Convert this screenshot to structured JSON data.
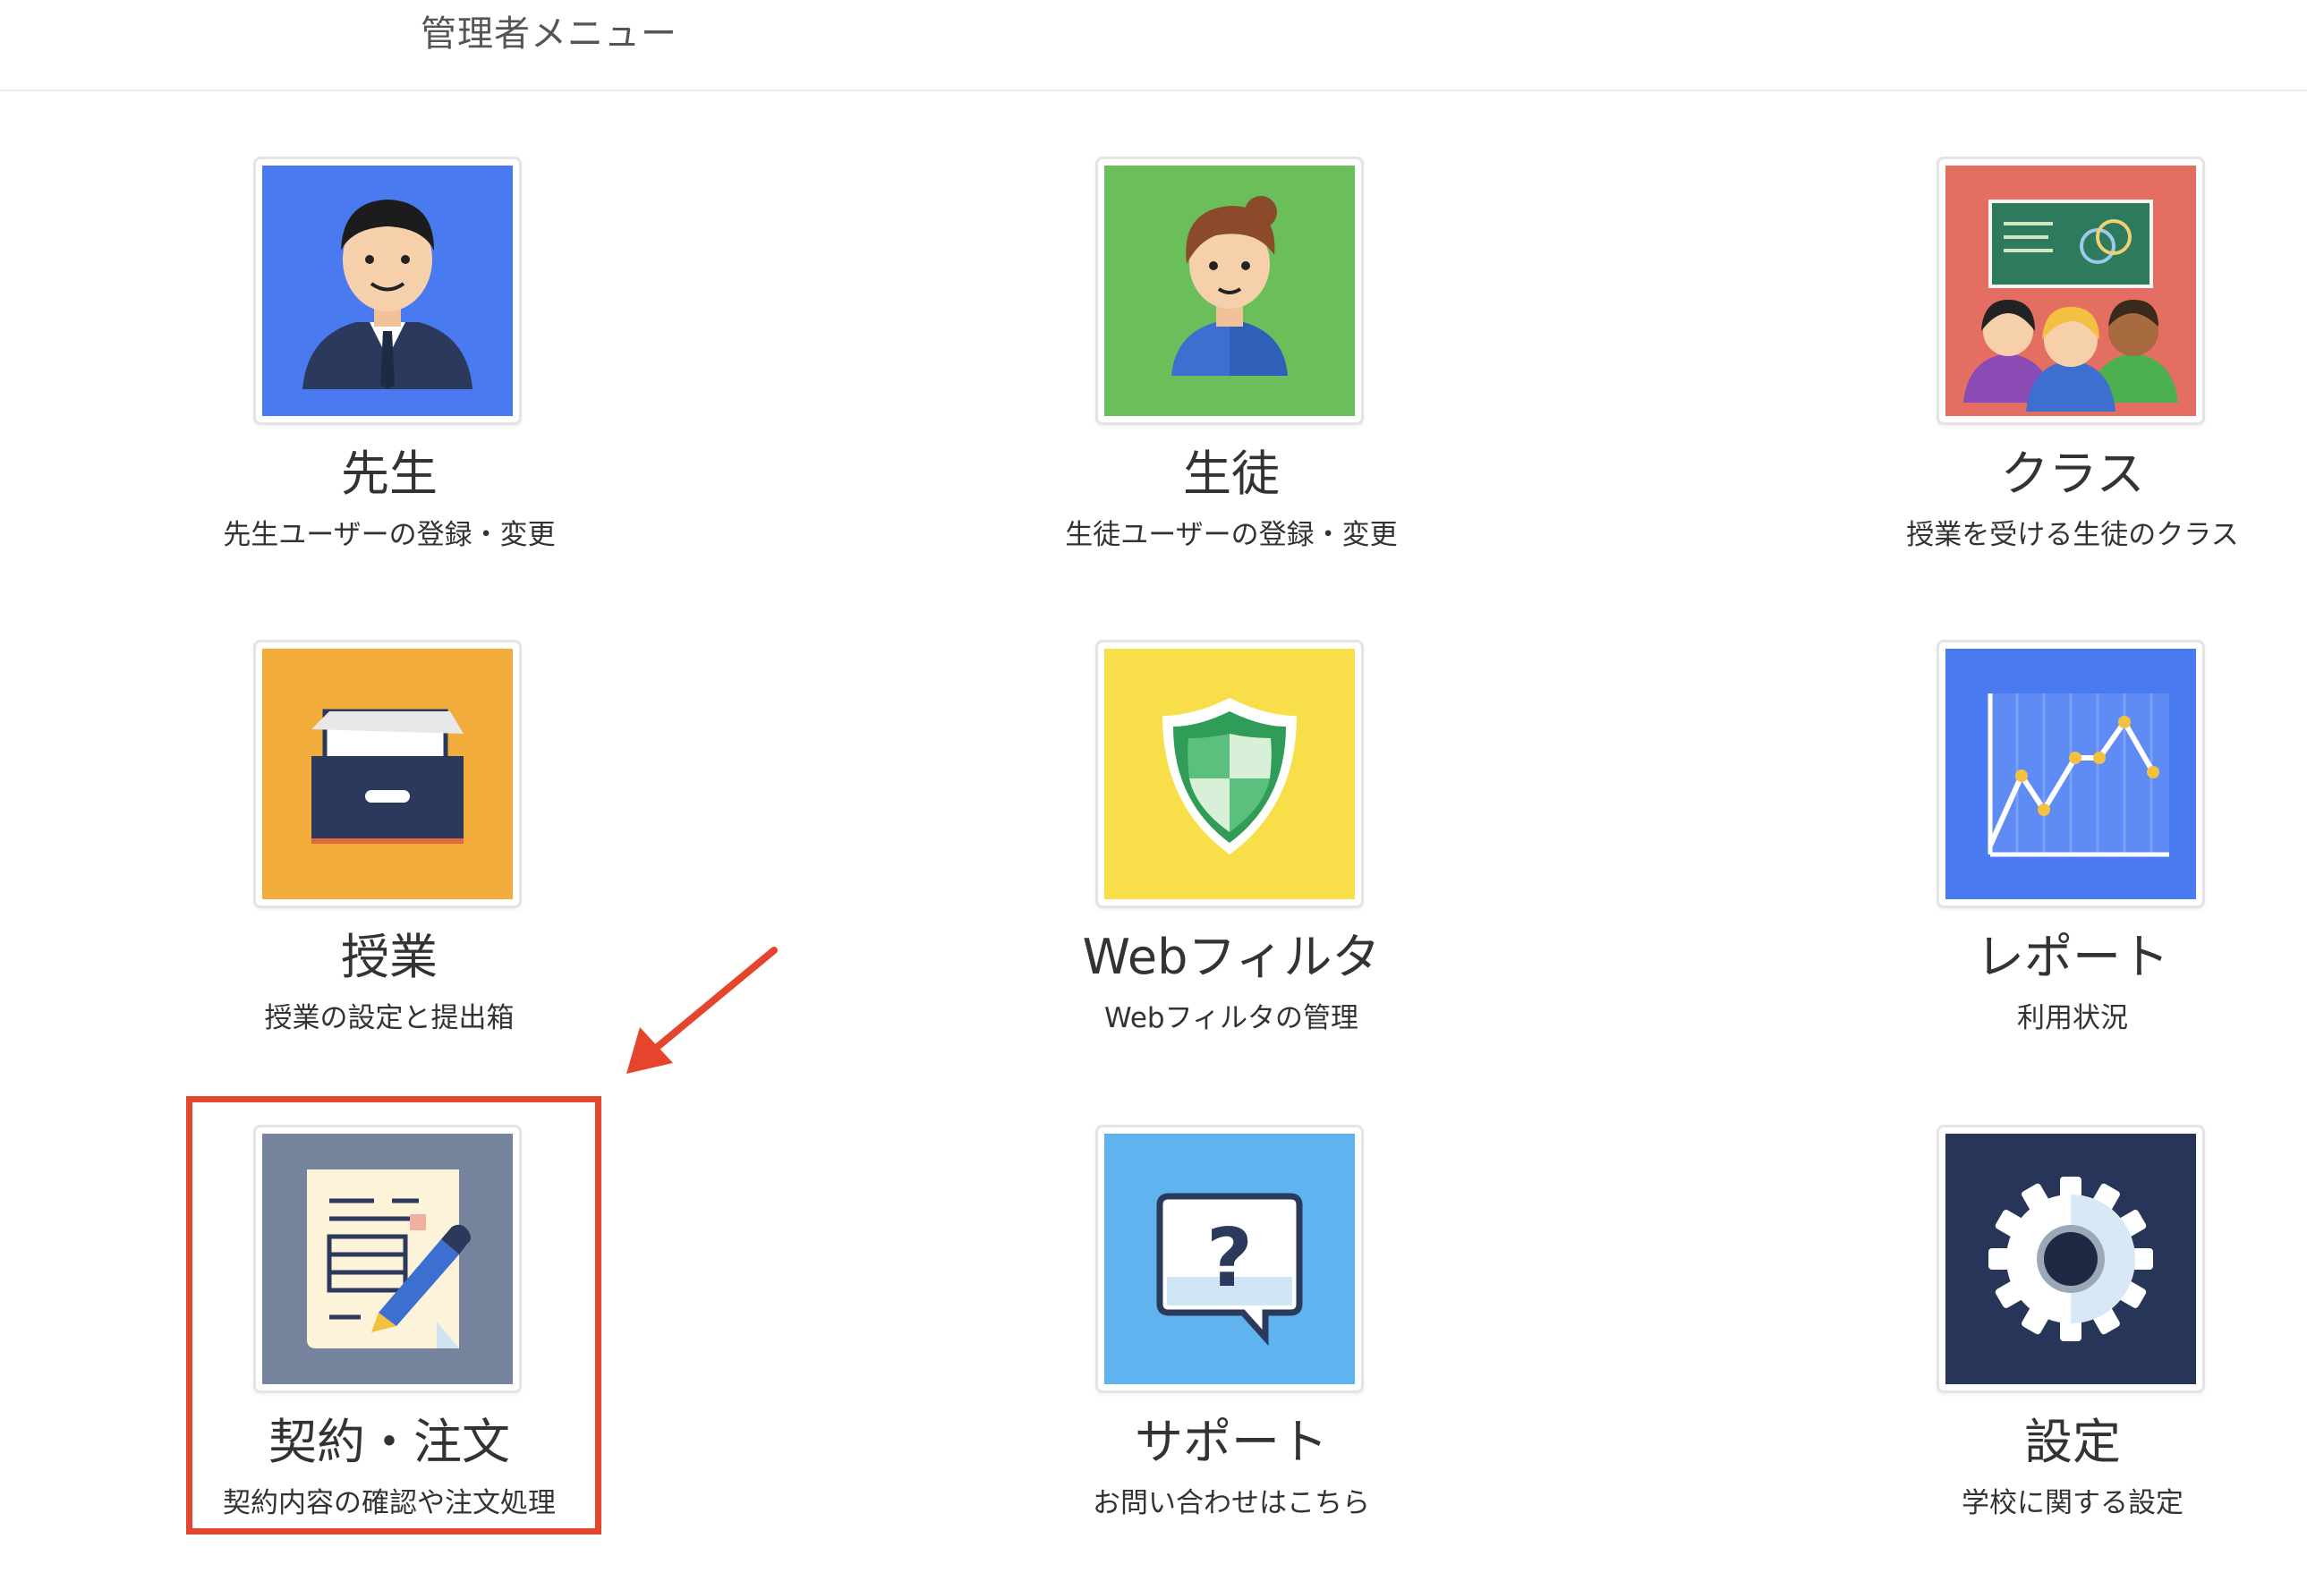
{
  "header": {
    "title": "管理者メニュー"
  },
  "menu": {
    "items": [
      {
        "key": "teacher",
        "title": "先生",
        "desc": "先生ユーザーの登録・変更",
        "icon": "teacher-icon",
        "bg": "#4a7af0"
      },
      {
        "key": "student",
        "title": "生徒",
        "desc": "生徒ユーザーの登録・変更",
        "icon": "student-icon",
        "bg": "#6bbf5b"
      },
      {
        "key": "class",
        "title": "クラス",
        "desc": "授業を受ける生徒のクラス",
        "icon": "class-icon",
        "bg": "#e56e63"
      },
      {
        "key": "lesson",
        "title": "授業",
        "desc": "授業の設定と提出箱",
        "icon": "drawer-icon",
        "bg": "#f2ac3c"
      },
      {
        "key": "filter",
        "title": "Webフィルタ",
        "desc": "Webフィルタの管理",
        "icon": "shield-icon",
        "bg": "#f8df4a"
      },
      {
        "key": "report",
        "title": "レポート",
        "desc": "利用状況",
        "icon": "chart-icon",
        "bg": "#4a7af0"
      },
      {
        "key": "contract",
        "title": "契約・注文",
        "desc": "契約内容の確認や注文処理",
        "icon": "contract-icon",
        "bg": "#75849c"
      },
      {
        "key": "support",
        "title": "サポート",
        "desc": "お問い合わせはこちら",
        "icon": "question-bubble-icon",
        "bg": "#5fb4f0"
      },
      {
        "key": "settings",
        "title": "設定",
        "desc": "学校に関する設定",
        "icon": "gear-icon",
        "bg": "#263558"
      }
    ]
  },
  "annotation": {
    "highlight_color": "#e5452c",
    "highlighted_item": "contract"
  }
}
